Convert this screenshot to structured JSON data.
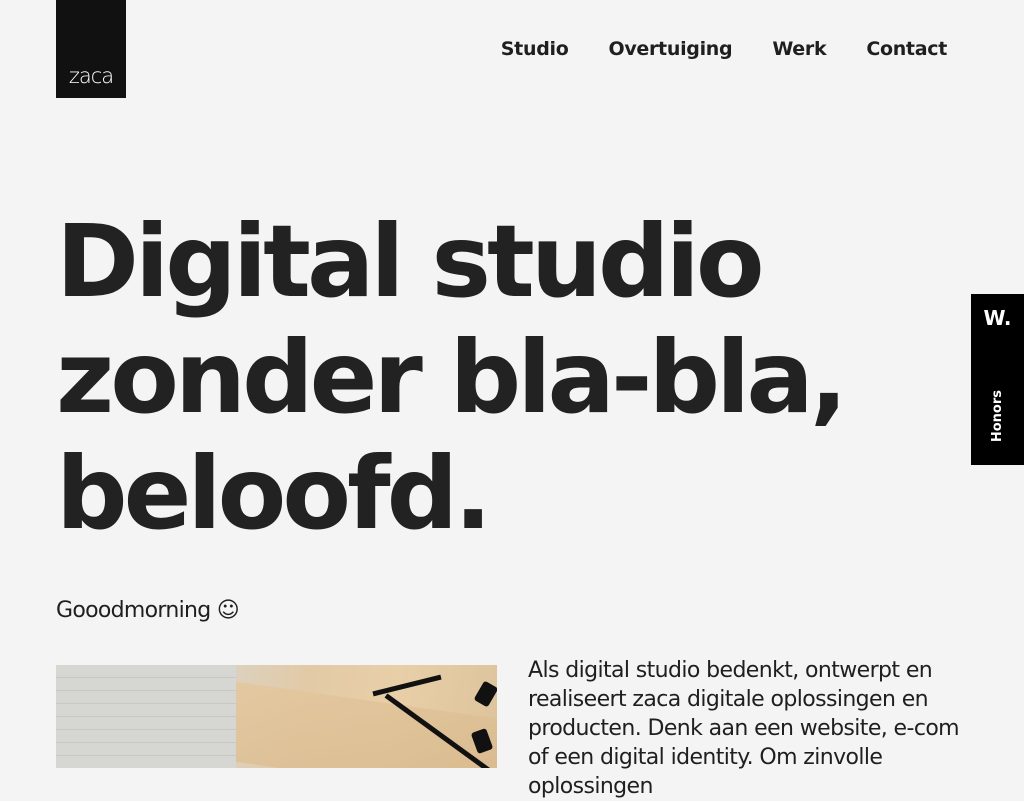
{
  "brand": {
    "logo_text": "zaca"
  },
  "nav": {
    "items": [
      {
        "label": "Studio"
      },
      {
        "label": "Overtuiging"
      },
      {
        "label": "Werk"
      },
      {
        "label": "Contact"
      }
    ]
  },
  "hero": {
    "lines": [
      "Digital studio",
      "zonder bla-bla,",
      "beloofd."
    ]
  },
  "greeting": "Gooodmorning ☺",
  "intro": "Als digital studio bedenkt, ontwerpt en realiseert zaca digitale oplossingen en producten. Denk aan een website, e-com of een digital identity. Om zinvolle oplossingen",
  "awards_badge": {
    "mark": "W.",
    "label": "Honors"
  },
  "colors": {
    "background": "#f4f4f4",
    "text": "#1f1f1f",
    "logo_bg": "#111111",
    "badge_bg": "#000000"
  }
}
